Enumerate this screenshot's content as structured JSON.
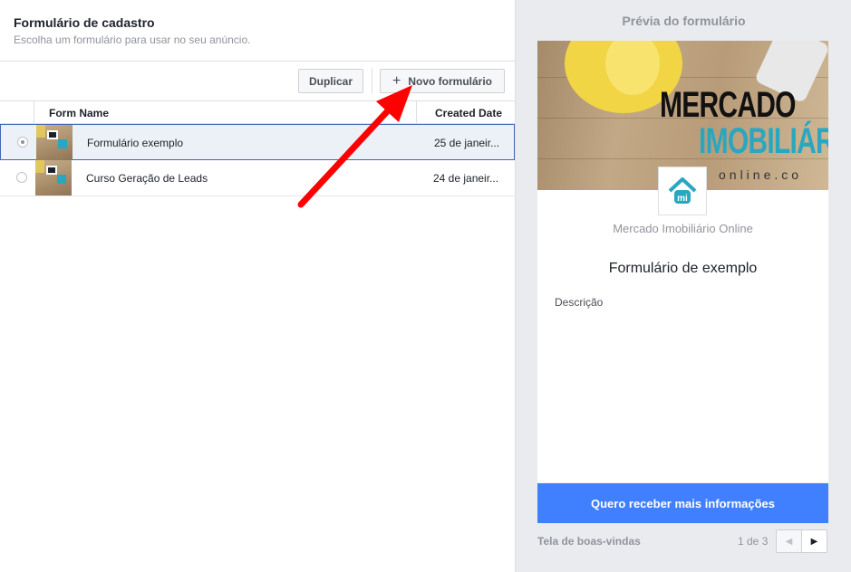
{
  "left_panel": {
    "title": "Formulário de cadastro",
    "subtitle": "Escolha um formulário para usar no seu anúncio.",
    "toolbar": {
      "duplicate_label": "Duplicar",
      "new_form_label": "Novo formulário"
    },
    "table": {
      "columns": [
        "Form Name",
        "Created Date"
      ],
      "rows": [
        {
          "name": "Formulário exemplo",
          "date": "25 de janeir...",
          "selected": true
        },
        {
          "name": "Curso Geração de Leads",
          "date": "24 de janeir...",
          "selected": false
        }
      ]
    }
  },
  "preview": {
    "title": "Prévia do formulário",
    "hero": {
      "logo_line1": "MERCADO",
      "logo_line2": "IMOBILIÁR",
      "logo_line3": "online.co"
    },
    "page_name": "Mercado Imobiliário Online",
    "form_title": "Formulário de exemplo",
    "description": "Descrição",
    "cta_label": "Quero receber mais informações",
    "footer_label": "Tela de boas-vindas",
    "pager_text": "1 de 3"
  },
  "colors": {
    "accent": "#4080ff",
    "selected_border": "#4267b2",
    "arrow": "#ff0000",
    "brand_teal": "#2aa7c0"
  }
}
